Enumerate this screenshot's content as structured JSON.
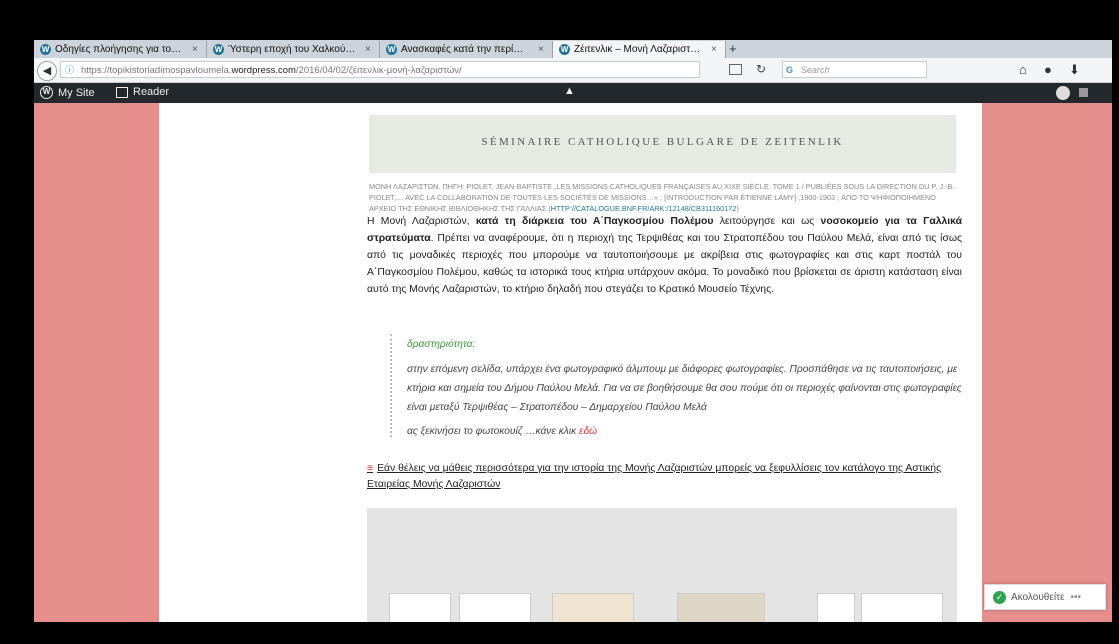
{
  "browser": {
    "tabs": [
      {
        "label": "Οδηγίες πλοήγησης για το…",
        "close": "×"
      },
      {
        "label": "Ύστερη εποχή του Χαλκού…",
        "close": "×"
      },
      {
        "label": "Ανασκαφές κατά την περί…",
        "close": "×"
      },
      {
        "label": "Ζέιτενλικ – Μονή Λαζαριστ…",
        "close": "×"
      }
    ],
    "new_tab": "+",
    "url_prefix": "https://topikistoriadimospavloumela.",
    "url_domain": "wordpress.com",
    "url_path": "/2016/04/02/ζέιτενλικ-μονή-λαζαριστών/",
    "search_placeholder": "Search"
  },
  "wp_bar": {
    "my_site": "My Site",
    "reader": "Reader"
  },
  "article": {
    "banner_text": "SÉMINAIRE CATHOLIQUE BULGARE DE ZEITENLIK",
    "caption_text": "ΜΟΝΗ ΛΑΖΑΡΙΣΤΩΝ. ΠΗΓΗ: PIOLET, JEAN-BAPTISTE „LES MISSIONS CATHOLIQUES FRANÇAISES AU XIXE SIÈCLE. TOME 1 / PUBLIÉES SOUS LA DIRECTION DU P. J.-B. PIOLET,… AVEC LA COLLABORATION DE TOUTES LES SOCIÉTÉS DE MISSIONS…» ; [INTRODUCTION PAR ÉTIENNE LAMY] ,1900-1903 , ΑΠΟ ΤΟ ΨΗΦΙΟΠΟΙΗΜΕΝΟ ΑΡΧΕΙΟ ΤΗΣ ΕΘΝΙΚΗΣ ΒΙΒΛΙΟΘΗΚΗΣ ΤΗΣ ΓΑΛΛΙΑΣ (",
    "caption_link": "HTTP://CATALOGUE.BNF.FR/ARK:/12148/CB311160172",
    "caption_end": ")",
    "p1_a": "Η Μονή Λαζαριστών, ",
    "p1_b": "κατά τη διάρκεια του Α΄Παγκοσμίου Πολέμου",
    "p1_c": " λειτούργησε και ως ",
    "p1_d": "νοσοκομείο για τα Γαλλικά στρατεύματα",
    "p1_e": ". Πρέπει να αναφέρουμε, ότι η περιοχή της Τερψιθέας και του Στρατοπέδου του Παύλου Μελά, είναι από τις ίσως από τις μοναδικές περιοχές που μπορούμε να ταυτοποιήσουμε με ακρίβεια στις φωτογραφίες και στις καρτ ποστάλ του Α΄Παγκοσμίου Πολέμου, καθώς τα ιστορικά τους κτήρια υπάρχουν ακόμα. Το μοναδικό που βρίσκεται σε άριστη κατάσταση είναι αυτό της Μονής Λαζαριστών, το κτήριο δηλαδή που στεγάζει το Κρατικό Μουσείο Τέχνης.",
    "activity_title": "δραστηριότητα:",
    "activity_body": "στην επόμενη σελίδα, υπάρχει ένα φωτογραφικό άλμπουμ με διάφορες φωτογραφίες. Προσπάθησε να τις ταυτοποιήσεις, με κτήρια και σημεία του Δήμου Παύλου Μελά. Για να σε βοηθήσουμε θα σου πούμε ότι οι περιοχές φαίνονται στις φωτογραφίες είναι μεταξύ Τερψιθέας – Στρατοπέδου – Δημαρχείου Παύλου Μελά",
    "activity_start": "ας ξεκινήσει το φωτοκουίζ …κάνε κλικ ",
    "activity_link": "εδώ",
    "more_link": "Εάν θέλεις να μάθεις περισσότερα για την ιστορία της Μονής Λαζαριστών μπορείς να ξεφυλλίσεις τον κατάλογο της Αστικής Εταιρείας Μονής Λαζαριστών"
  },
  "follow": {
    "label": "Ακολουθείτε",
    "more": "•••"
  }
}
